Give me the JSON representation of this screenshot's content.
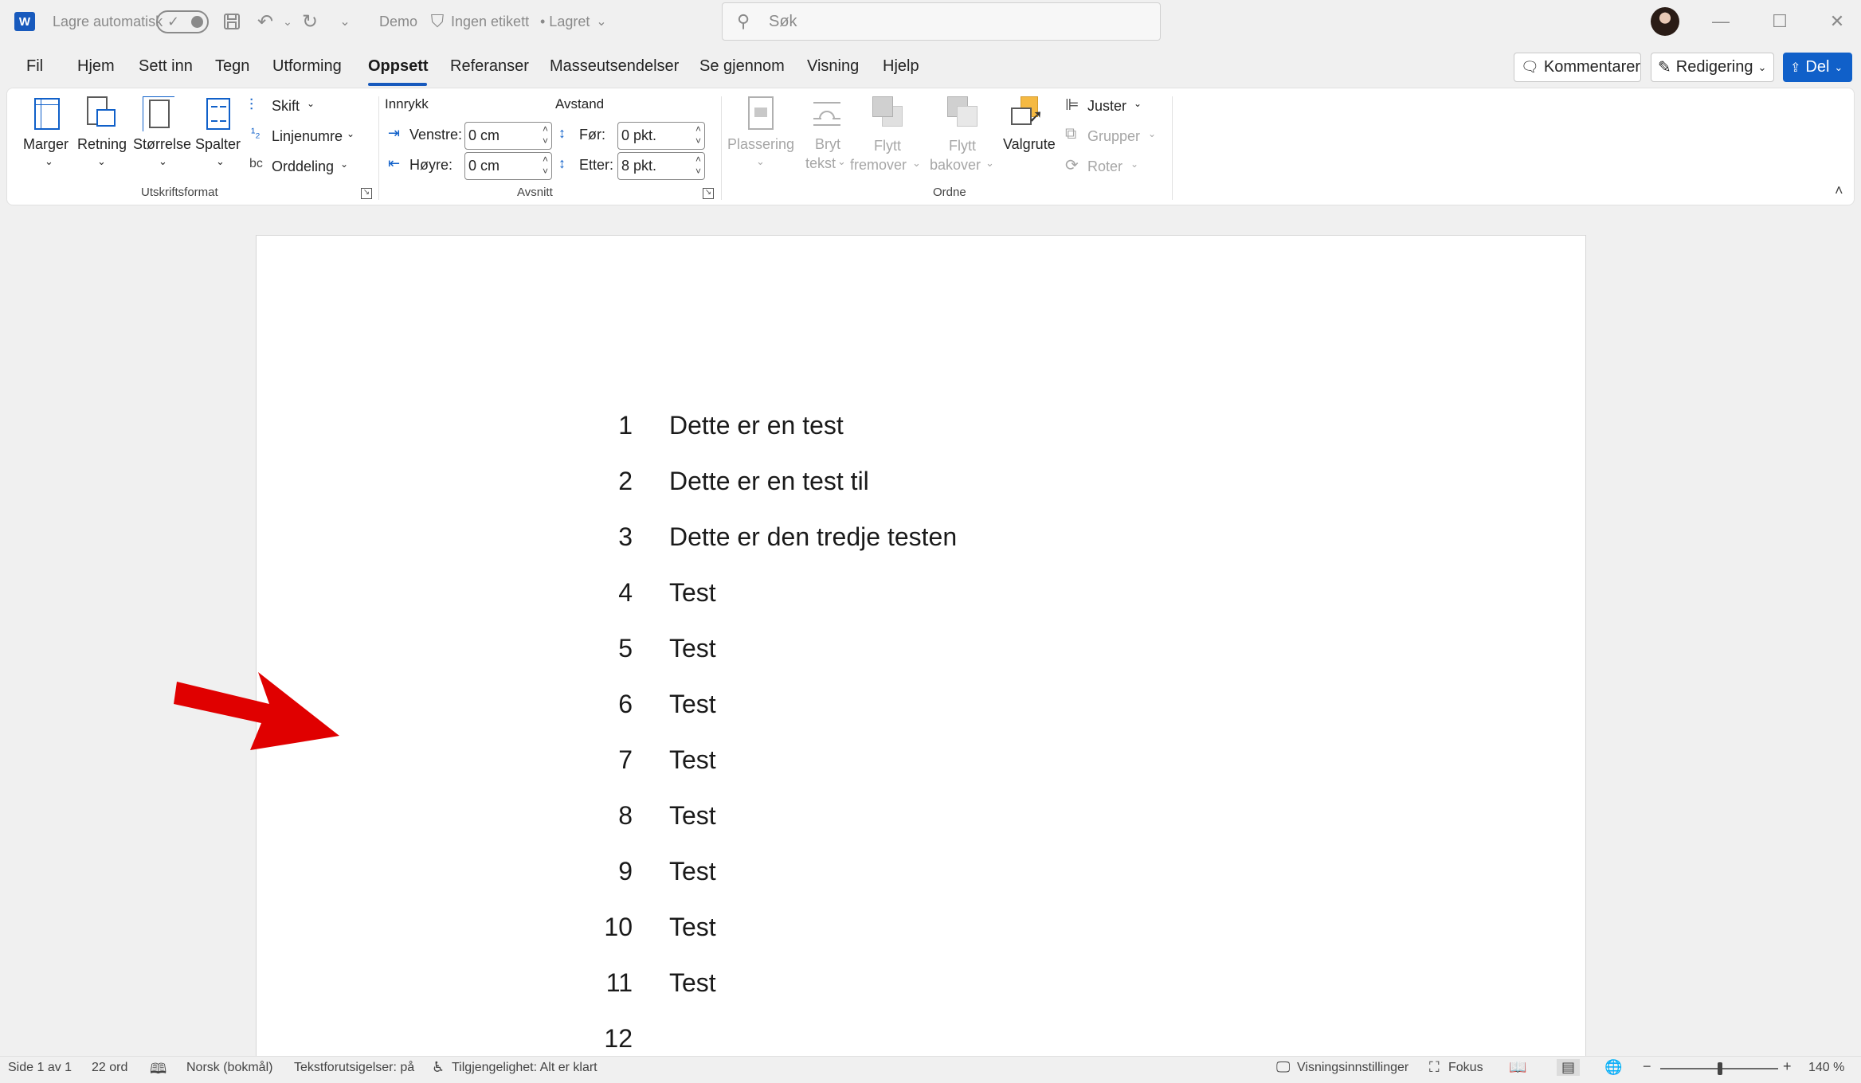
{
  "titlebar": {
    "app_icon": "W",
    "autosave_label": "Lagre automatisk",
    "doc_name": "Demo",
    "sensitivity": "Ingen etikett",
    "save_status": "• Lagret",
    "search_placeholder": "Søk"
  },
  "menu": {
    "tabs": [
      "Fil",
      "Hjem",
      "Sett inn",
      "Tegn",
      "Utforming",
      "Oppsett",
      "Referanser",
      "Masseutsendelser",
      "Se gjennom",
      "Visning",
      "Hjelp"
    ],
    "active_tab": "Oppsett",
    "comments_label": "Kommentarer",
    "editing_label": "Redigering",
    "share_label": "Del"
  },
  "ribbon": {
    "page_setup": {
      "margins": "Marger",
      "orientation": "Retning",
      "size": "Størrelse",
      "columns": "Spalter",
      "breaks": "Skift",
      "line_numbers": "Linjenumre",
      "hyphenation": "Orddeling",
      "group_label": "Utskriftsformat"
    },
    "paragraph": {
      "indent_header": "Innrykk",
      "spacing_header": "Avstand",
      "left_label": "Venstre:",
      "left_value": "0 cm",
      "right_label": "Høyre:",
      "right_value": "0 cm",
      "before_label": "Før:",
      "before_value": "0 pkt.",
      "after_label": "Etter:",
      "after_value": "8 pkt.",
      "group_label": "Avsnitt"
    },
    "arrange": {
      "position_l1": "Plassering",
      "wrap_l1": "Bryt",
      "wrap_l2": "tekst",
      "forward_l1": "Flytt",
      "forward_l2": "fremover",
      "backward_l1": "Flytt",
      "backward_l2": "bakover",
      "selection_pane": "Valgrute",
      "align": "Juster",
      "group": "Grupper",
      "rotate": "Roter",
      "group_label": "Ordne"
    }
  },
  "document": {
    "lines": [
      {
        "num": "1",
        "text": "Dette er en test"
      },
      {
        "num": "2",
        "text": "Dette er en test til"
      },
      {
        "num": "3",
        "text": "Dette er den tredje testen"
      },
      {
        "num": "4",
        "text": "Test"
      },
      {
        "num": "5",
        "text": "Test"
      },
      {
        "num": "6",
        "text": "Test"
      },
      {
        "num": "7",
        "text": "Test"
      },
      {
        "num": "8",
        "text": "Test"
      },
      {
        "num": "9",
        "text": "Test"
      },
      {
        "num": "10",
        "text": "Test"
      },
      {
        "num": "11",
        "text": "Test"
      },
      {
        "num": "12",
        "text": ""
      }
    ]
  },
  "statusbar": {
    "page": "Side 1 av 1",
    "words": "22 ord",
    "language": "Norsk (bokmål)",
    "predictions": "Tekstforutsigelser: på",
    "accessibility": "Tilgjengelighet: Alt er klart",
    "display_settings": "Visningsinnstillinger",
    "focus": "Fokus",
    "zoom": "140 %",
    "zoom_level_fraction": 0.51
  },
  "colors": {
    "accent": "#185abd",
    "share": "#1060c9",
    "arrow": "#e00000"
  }
}
